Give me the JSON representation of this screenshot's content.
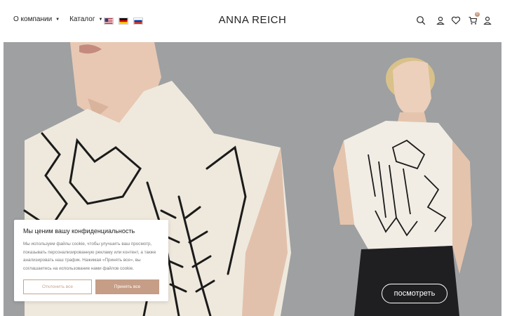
{
  "header": {
    "nav": [
      {
        "label": "О компании"
      },
      {
        "label": "Каталог"
      }
    ],
    "flags": [
      "us-flag-icon",
      "de-flag-icon",
      "ru-flag-icon"
    ],
    "logo": "ANNA REICH",
    "icons": [
      "search-icon",
      "user-icon",
      "heart-icon",
      "cart-icon",
      "account-icon"
    ],
    "cart_count": "0"
  },
  "cookie": {
    "title": "Мы ценим вашу конфиденциальность",
    "text": "Мы используем файлы cookie, чтобы улучшить ваш просмотр, показывать персонализированную рекламу или контент, а также анализировать наш трафик. Нажимая «Принять все», вы соглашаетесь на использование нами файлов cookie.",
    "decline_label": "Отклонить все",
    "accept_label": "Принять все"
  },
  "hero": {
    "view_label": "посмотреть"
  }
}
